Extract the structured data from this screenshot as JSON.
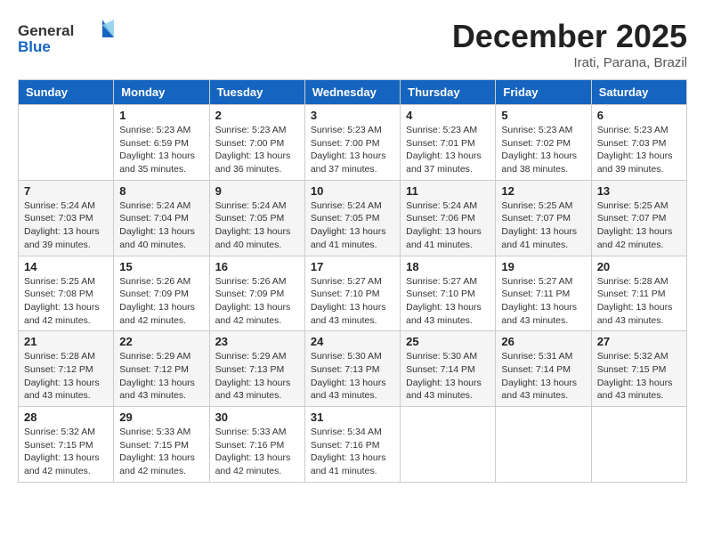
{
  "header": {
    "logo_general": "General",
    "logo_blue": "Blue",
    "month_title": "December 2025",
    "location": "Irati, Parana, Brazil"
  },
  "columns": [
    "Sunday",
    "Monday",
    "Tuesday",
    "Wednesday",
    "Thursday",
    "Friday",
    "Saturday"
  ],
  "weeks": [
    [
      {
        "day": "",
        "info": ""
      },
      {
        "day": "1",
        "info": "Sunrise: 5:23 AM\nSunset: 6:59 PM\nDaylight: 13 hours\nand 35 minutes."
      },
      {
        "day": "2",
        "info": "Sunrise: 5:23 AM\nSunset: 7:00 PM\nDaylight: 13 hours\nand 36 minutes."
      },
      {
        "day": "3",
        "info": "Sunrise: 5:23 AM\nSunset: 7:00 PM\nDaylight: 13 hours\nand 37 minutes."
      },
      {
        "day": "4",
        "info": "Sunrise: 5:23 AM\nSunset: 7:01 PM\nDaylight: 13 hours\nand 37 minutes."
      },
      {
        "day": "5",
        "info": "Sunrise: 5:23 AM\nSunset: 7:02 PM\nDaylight: 13 hours\nand 38 minutes."
      },
      {
        "day": "6",
        "info": "Sunrise: 5:23 AM\nSunset: 7:03 PM\nDaylight: 13 hours\nand 39 minutes."
      }
    ],
    [
      {
        "day": "7",
        "info": "Sunrise: 5:24 AM\nSunset: 7:03 PM\nDaylight: 13 hours\nand 39 minutes."
      },
      {
        "day": "8",
        "info": "Sunrise: 5:24 AM\nSunset: 7:04 PM\nDaylight: 13 hours\nand 40 minutes."
      },
      {
        "day": "9",
        "info": "Sunrise: 5:24 AM\nSunset: 7:05 PM\nDaylight: 13 hours\nand 40 minutes."
      },
      {
        "day": "10",
        "info": "Sunrise: 5:24 AM\nSunset: 7:05 PM\nDaylight: 13 hours\nand 41 minutes."
      },
      {
        "day": "11",
        "info": "Sunrise: 5:24 AM\nSunset: 7:06 PM\nDaylight: 13 hours\nand 41 minutes."
      },
      {
        "day": "12",
        "info": "Sunrise: 5:25 AM\nSunset: 7:07 PM\nDaylight: 13 hours\nand 41 minutes."
      },
      {
        "day": "13",
        "info": "Sunrise: 5:25 AM\nSunset: 7:07 PM\nDaylight: 13 hours\nand 42 minutes."
      }
    ],
    [
      {
        "day": "14",
        "info": "Sunrise: 5:25 AM\nSunset: 7:08 PM\nDaylight: 13 hours\nand 42 minutes."
      },
      {
        "day": "15",
        "info": "Sunrise: 5:26 AM\nSunset: 7:09 PM\nDaylight: 13 hours\nand 42 minutes."
      },
      {
        "day": "16",
        "info": "Sunrise: 5:26 AM\nSunset: 7:09 PM\nDaylight: 13 hours\nand 42 minutes."
      },
      {
        "day": "17",
        "info": "Sunrise: 5:27 AM\nSunset: 7:10 PM\nDaylight: 13 hours\nand 43 minutes."
      },
      {
        "day": "18",
        "info": "Sunrise: 5:27 AM\nSunset: 7:10 PM\nDaylight: 13 hours\nand 43 minutes."
      },
      {
        "day": "19",
        "info": "Sunrise: 5:27 AM\nSunset: 7:11 PM\nDaylight: 13 hours\nand 43 minutes."
      },
      {
        "day": "20",
        "info": "Sunrise: 5:28 AM\nSunset: 7:11 PM\nDaylight: 13 hours\nand 43 minutes."
      }
    ],
    [
      {
        "day": "21",
        "info": "Sunrise: 5:28 AM\nSunset: 7:12 PM\nDaylight: 13 hours\nand 43 minutes."
      },
      {
        "day": "22",
        "info": "Sunrise: 5:29 AM\nSunset: 7:12 PM\nDaylight: 13 hours\nand 43 minutes."
      },
      {
        "day": "23",
        "info": "Sunrise: 5:29 AM\nSunset: 7:13 PM\nDaylight: 13 hours\nand 43 minutes."
      },
      {
        "day": "24",
        "info": "Sunrise: 5:30 AM\nSunset: 7:13 PM\nDaylight: 13 hours\nand 43 minutes."
      },
      {
        "day": "25",
        "info": "Sunrise: 5:30 AM\nSunset: 7:14 PM\nDaylight: 13 hours\nand 43 minutes."
      },
      {
        "day": "26",
        "info": "Sunrise: 5:31 AM\nSunset: 7:14 PM\nDaylight: 13 hours\nand 43 minutes."
      },
      {
        "day": "27",
        "info": "Sunrise: 5:32 AM\nSunset: 7:15 PM\nDaylight: 13 hours\nand 43 minutes."
      }
    ],
    [
      {
        "day": "28",
        "info": "Sunrise: 5:32 AM\nSunset: 7:15 PM\nDaylight: 13 hours\nand 42 minutes."
      },
      {
        "day": "29",
        "info": "Sunrise: 5:33 AM\nSunset: 7:15 PM\nDaylight: 13 hours\nand 42 minutes."
      },
      {
        "day": "30",
        "info": "Sunrise: 5:33 AM\nSunset: 7:16 PM\nDaylight: 13 hours\nand 42 minutes."
      },
      {
        "day": "31",
        "info": "Sunrise: 5:34 AM\nSunset: 7:16 PM\nDaylight: 13 hours\nand 41 minutes."
      },
      {
        "day": "",
        "info": ""
      },
      {
        "day": "",
        "info": ""
      },
      {
        "day": "",
        "info": ""
      }
    ]
  ]
}
